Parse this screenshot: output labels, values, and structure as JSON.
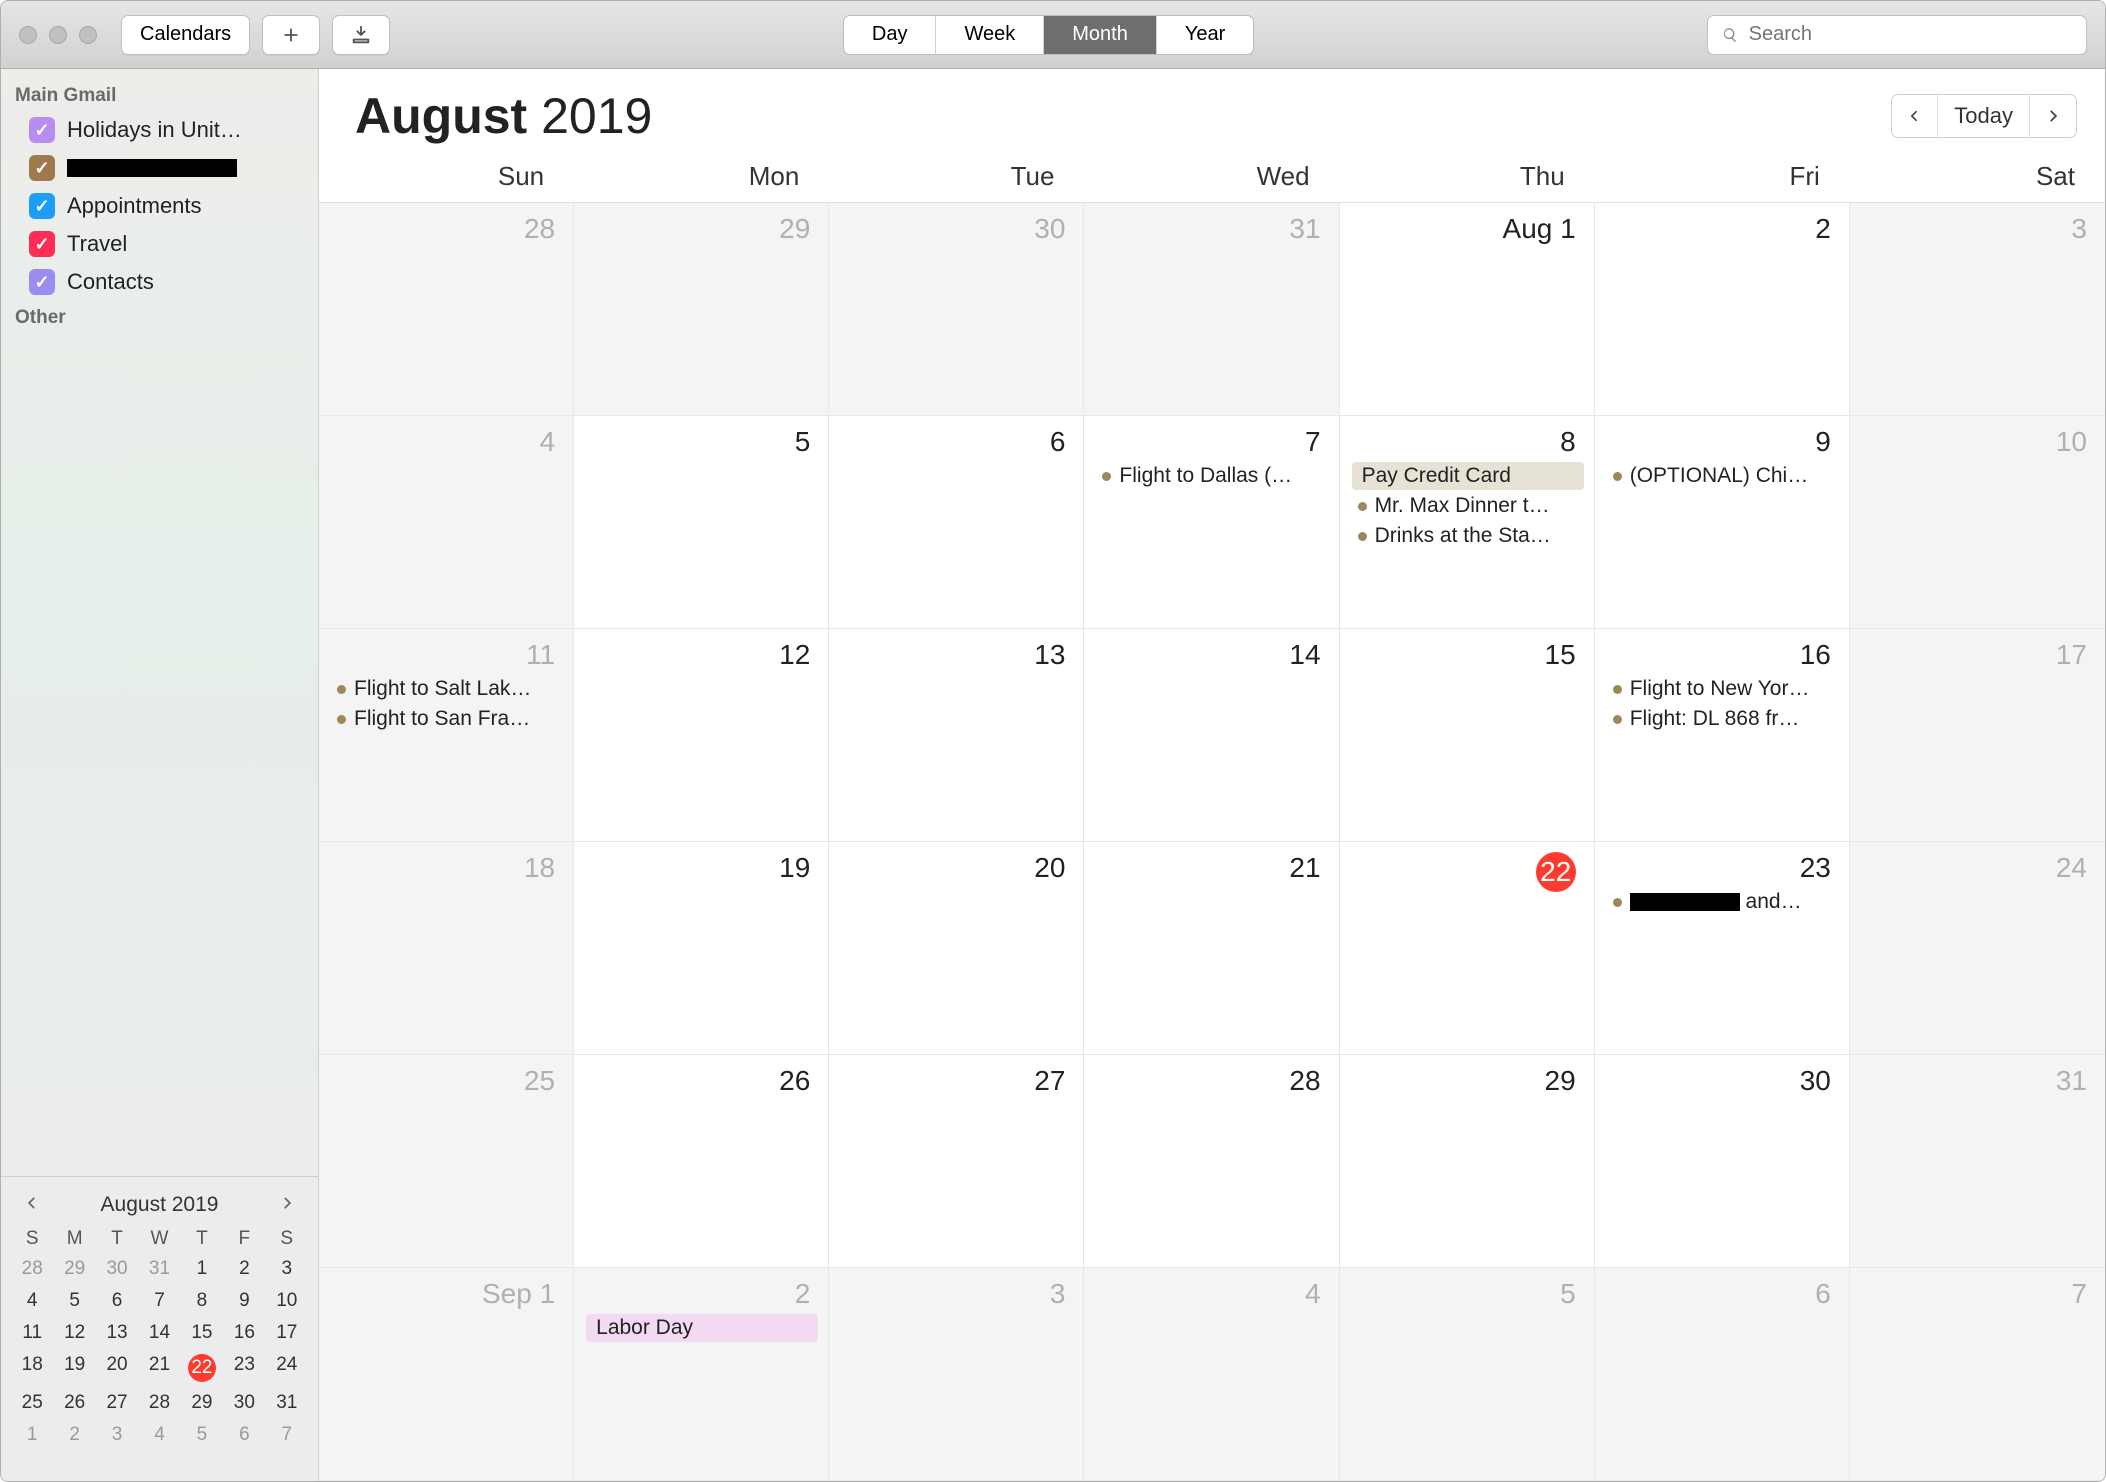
{
  "toolbar": {
    "calendars_label": "Calendars",
    "views": [
      "Day",
      "Week",
      "Month",
      "Year"
    ],
    "active_view": "Month",
    "search_placeholder": "Search"
  },
  "sidebar": {
    "groups": [
      {
        "name": "Main Gmail",
        "items": [
          {
            "label": "Holidays in Unit…",
            "color": "#b98df0",
            "checked": true
          },
          {
            "label": "████████████",
            "color": "#9f7a4c",
            "checked": true,
            "redacted": true
          },
          {
            "label": "Appointments",
            "color": "#1e9df7",
            "checked": true
          },
          {
            "label": "Travel",
            "color": "#ff2d55",
            "checked": true
          },
          {
            "label": "Contacts",
            "color": "#9c8cf0",
            "checked": true
          }
        ]
      },
      {
        "name": "Other",
        "items": []
      }
    ]
  },
  "mini": {
    "title": "August 2019",
    "dow": [
      "S",
      "M",
      "T",
      "W",
      "T",
      "F",
      "S"
    ],
    "days": [
      {
        "n": 28,
        "o": true
      },
      {
        "n": 29,
        "o": true
      },
      {
        "n": 30,
        "o": true
      },
      {
        "n": 31,
        "o": true
      },
      {
        "n": 1
      },
      {
        "n": 2
      },
      {
        "n": 3
      },
      {
        "n": 4
      },
      {
        "n": 5
      },
      {
        "n": 6
      },
      {
        "n": 7
      },
      {
        "n": 8
      },
      {
        "n": 9
      },
      {
        "n": 10
      },
      {
        "n": 11
      },
      {
        "n": 12
      },
      {
        "n": 13
      },
      {
        "n": 14
      },
      {
        "n": 15
      },
      {
        "n": 16
      },
      {
        "n": 17
      },
      {
        "n": 18
      },
      {
        "n": 19
      },
      {
        "n": 20
      },
      {
        "n": 21
      },
      {
        "n": 22,
        "t": true
      },
      {
        "n": 23
      },
      {
        "n": 24
      },
      {
        "n": 25
      },
      {
        "n": 26
      },
      {
        "n": 27
      },
      {
        "n": 28
      },
      {
        "n": 29
      },
      {
        "n": 30
      },
      {
        "n": 31
      },
      {
        "n": 1,
        "o": true
      },
      {
        "n": 2,
        "o": true
      },
      {
        "n": 3,
        "o": true
      },
      {
        "n": 4,
        "o": true
      },
      {
        "n": 5,
        "o": true
      },
      {
        "n": 6,
        "o": true
      },
      {
        "n": 7,
        "o": true
      }
    ]
  },
  "main": {
    "month_bold": "August",
    "month_rest": " 2019",
    "today_label": "Today",
    "dow": [
      "Sun",
      "Mon",
      "Tue",
      "Wed",
      "Thu",
      "Fri",
      "Sat"
    ],
    "cells": [
      {
        "label": "28",
        "other": true
      },
      {
        "label": "29",
        "other": true
      },
      {
        "label": "30",
        "other": true
      },
      {
        "label": "31",
        "other": true
      },
      {
        "label": "Aug 1"
      },
      {
        "label": "2"
      },
      {
        "label": "3",
        "other": true
      },
      {
        "label": "4",
        "other": true
      },
      {
        "label": "5"
      },
      {
        "label": "6"
      },
      {
        "label": "7",
        "events": [
          {
            "t": "Flight to Dallas (…",
            "dot": true
          }
        ]
      },
      {
        "label": "8",
        "events": [
          {
            "t": "Pay Credit Card",
            "allday": true
          },
          {
            "t": "Mr. Max Dinner t…",
            "dot": true
          },
          {
            "t": "Drinks at the Sta…",
            "dot": true
          }
        ]
      },
      {
        "label": "9",
        "events": [
          {
            "t": "(OPTIONAL) Chi…",
            "dot": true
          }
        ]
      },
      {
        "label": "10",
        "other": true
      },
      {
        "label": "11",
        "other": true,
        "events": [
          {
            "t": "Flight to Salt Lak…",
            "dot": true
          },
          {
            "t": "Flight to San Fra…",
            "dot": true
          }
        ]
      },
      {
        "label": "12"
      },
      {
        "label": "13"
      },
      {
        "label": "14"
      },
      {
        "label": "15"
      },
      {
        "label": "16",
        "events": [
          {
            "t": "Flight to New Yor…",
            "dot": true
          },
          {
            "t": "Flight: DL 868 fr…",
            "dot": true
          }
        ]
      },
      {
        "label": "17",
        "other": true
      },
      {
        "label": "18",
        "other": true
      },
      {
        "label": "19"
      },
      {
        "label": "20"
      },
      {
        "label": "21"
      },
      {
        "label": "22",
        "today": true
      },
      {
        "label": "23",
        "events": [
          {
            "t": "██████████ and…",
            "dot": true,
            "redacted": true
          }
        ]
      },
      {
        "label": "24",
        "other": true
      },
      {
        "label": "25",
        "other": true
      },
      {
        "label": "26"
      },
      {
        "label": "27"
      },
      {
        "label": "28"
      },
      {
        "label": "29"
      },
      {
        "label": "30"
      },
      {
        "label": "31",
        "other": true
      },
      {
        "label": "Sep 1",
        "other": true
      },
      {
        "label": "2",
        "other": true,
        "events": [
          {
            "t": "Labor Day",
            "holiday": true
          }
        ]
      },
      {
        "label": "3",
        "other": true
      },
      {
        "label": "4",
        "other": true
      },
      {
        "label": "5",
        "other": true
      },
      {
        "label": "6",
        "other": true
      },
      {
        "label": "7",
        "other": true
      }
    ]
  }
}
